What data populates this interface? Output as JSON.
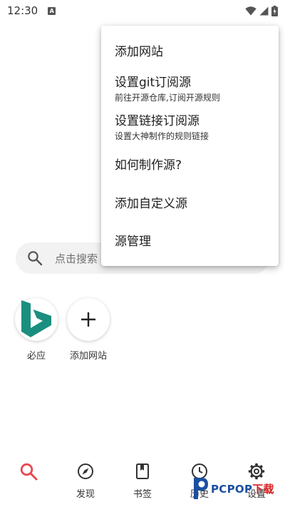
{
  "status_bar": {
    "time": "12:30",
    "notif_letter": "A"
  },
  "search": {
    "placeholder": "点击搜索"
  },
  "shortcuts": [
    {
      "label": "必应",
      "icon": "bing-logo-icon"
    },
    {
      "label": "添加网站",
      "icon": "plus-icon"
    }
  ],
  "menu": {
    "items": [
      {
        "title": "添加网站"
      },
      {
        "title": "设置git订阅源",
        "subtitle": "前往开源仓库,订阅开源规则"
      },
      {
        "title": "设置链接订阅源",
        "subtitle": "设置大神制作的规则链接"
      },
      {
        "title": "如何制作源?"
      },
      {
        "title": "添加自定义源"
      },
      {
        "title": "源管理"
      }
    ]
  },
  "bottom_nav": {
    "items": [
      {
        "label": "",
        "icon": "search-icon"
      },
      {
        "label": "发现",
        "icon": "compass-icon"
      },
      {
        "label": "书签",
        "icon": "bookmark-icon"
      },
      {
        "label": "历史",
        "icon": "history-icon"
      },
      {
        "label": "设置",
        "icon": "gear-icon"
      }
    ]
  },
  "watermark": {
    "brand": "PCPOP",
    "suffix": "下载"
  },
  "colors": {
    "accent": "#e8474d",
    "bing": "#1a8f7f",
    "menu_bg": "#ffffff",
    "search_bg": "#f2f2f2"
  }
}
